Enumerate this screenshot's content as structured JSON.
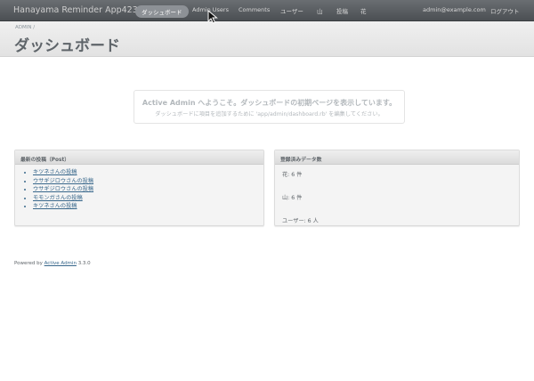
{
  "header": {
    "site_title": "Hanayama Reminder App42329",
    "nav": [
      {
        "label": "ダッシュボード",
        "current": true
      },
      {
        "label": "Admin Users"
      },
      {
        "label": "Comments"
      },
      {
        "label": "ユーザー"
      },
      {
        "label": "山"
      },
      {
        "label": "投稿"
      },
      {
        "label": "花"
      }
    ],
    "user_email": "admin@example.com",
    "logout": "ログアウト"
  },
  "title_bar": {
    "breadcrumb": "ADMIN /",
    "title": "ダッシュボード"
  },
  "blank_slate": {
    "title": "Active Admin へようこそ。ダッシュボードの初期ページを表示しています。",
    "subtitle": "ダッシュボードに項目を追加するために 'app/admin/dashboard.rb' を編集してください。"
  },
  "recent_posts": {
    "title": "最新の投稿（Post）",
    "items": [
      "キツネさんの投稿",
      "ウサギジロウさんの投稿",
      "ウサギジロウさんの投稿",
      "モモンガさんの投稿",
      "キツネさんの投稿"
    ]
  },
  "counts": {
    "title": "登録済みデータ数",
    "flowers": "花: 6 件",
    "mountains": "山: 6 件",
    "users": "ユーザー: 6 人"
  },
  "footer": {
    "prefix": "Powered by",
    "link": "Active Admin",
    "version": "3.3.0"
  },
  "colors": {
    "header_bg": "#555a5e",
    "link": "#38678b",
    "text": "#5e6469"
  }
}
